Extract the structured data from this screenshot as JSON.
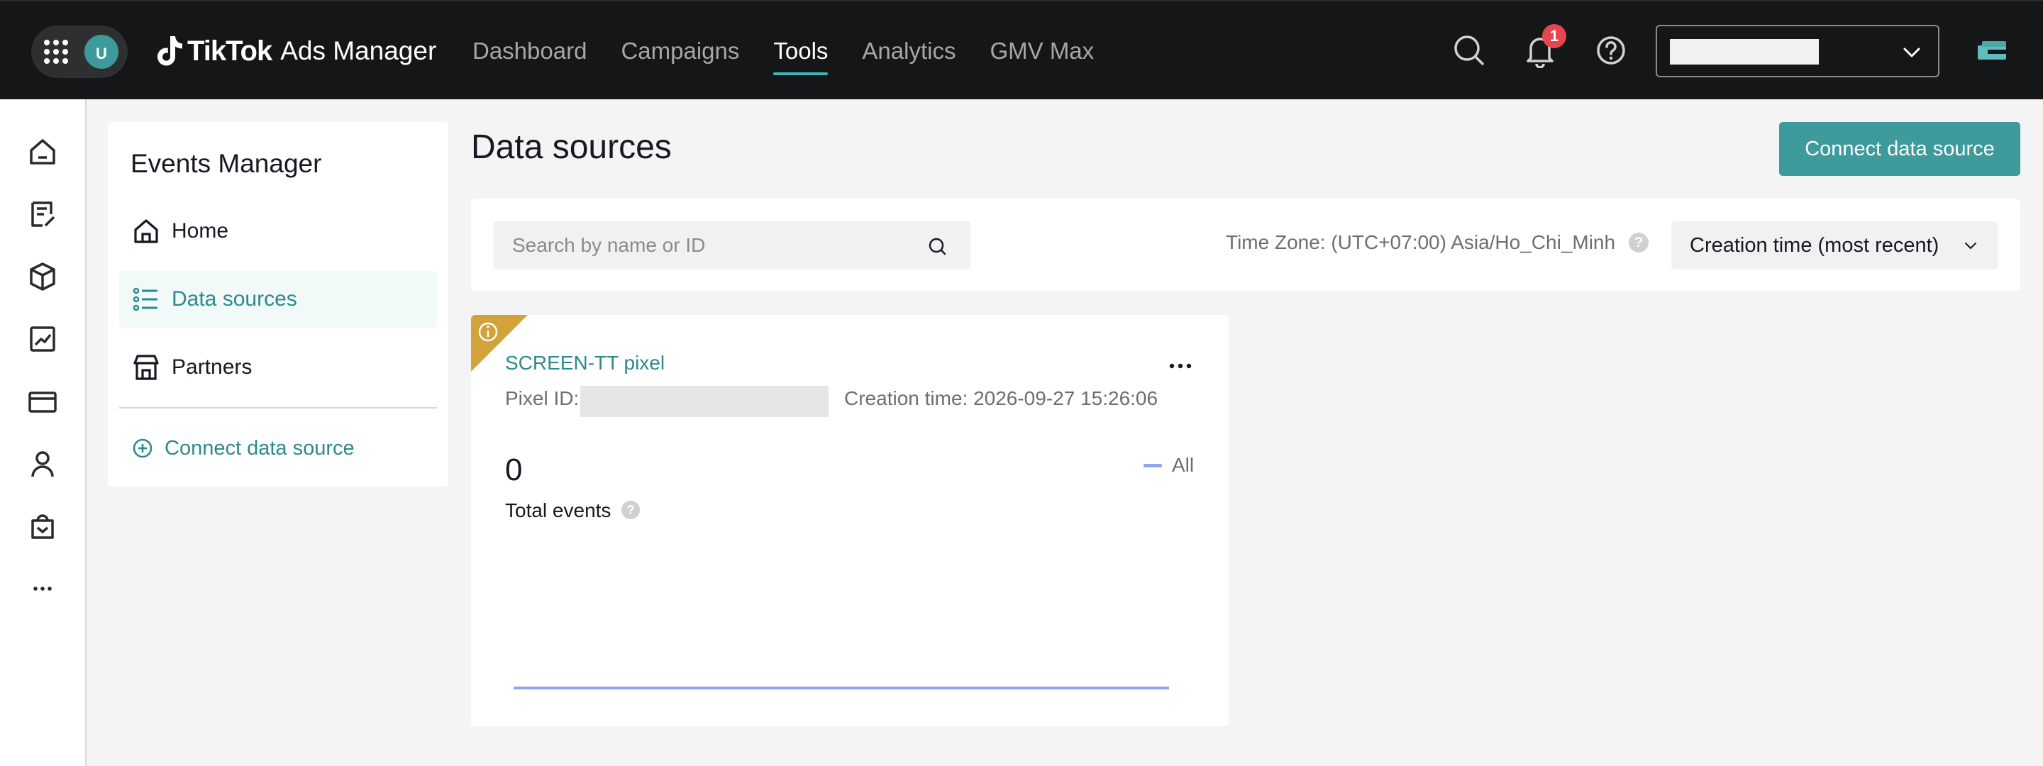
{
  "topbar": {
    "avatar_initial": "U",
    "brand_name": "TikTok",
    "brand_sub": "Ads Manager",
    "nav": [
      {
        "label": "Dashboard",
        "active": false
      },
      {
        "label": "Campaigns",
        "active": false
      },
      {
        "label": "Tools",
        "active": true
      },
      {
        "label": "Analytics",
        "active": false
      },
      {
        "label": "GMV Max",
        "active": false
      }
    ],
    "notifications_count": "1",
    "account_value": "",
    "icons": [
      "apps-icon",
      "search-icon",
      "bell-icon",
      "help-icon",
      "chevron-down-icon",
      "briefcase-icon"
    ]
  },
  "rail": {
    "icons": [
      "home-icon",
      "campaign-icon",
      "assets-icon",
      "reporting-icon",
      "payment-icon",
      "account-icon",
      "business-icon",
      "more-icon"
    ]
  },
  "events_manager": {
    "title": "Events Manager",
    "items": [
      {
        "label": "Home",
        "icon": "home-icon",
        "active": false
      },
      {
        "label": "Data sources",
        "icon": "list-icon",
        "active": true
      },
      {
        "label": "Partners",
        "icon": "store-icon",
        "active": false
      }
    ],
    "connect_label": "Connect data source"
  },
  "main": {
    "title": "Data sources",
    "connect_button": "Connect data source",
    "search_placeholder": "Search by name or ID",
    "search_value": "",
    "timezone": "Time Zone: (UTC+07:00) Asia/Ho_Chi_Minh",
    "sort_selected": "Creation time (most recent)"
  },
  "pixel_card": {
    "name": "SCREEN-TT pixel",
    "pixel_id_label": "Pixel ID:",
    "pixel_id_value": "",
    "creation_time": "Creation time: 2026-09-27 15:26:06",
    "total_value": "0",
    "total_label": "Total events",
    "legend": "All",
    "series_color": "#8fa6ec"
  },
  "colors": {
    "accent": "#3f9a9b",
    "accent_text": "#2b8a8d",
    "warning_corner": "#d1a33a",
    "topbar_bg": "#151617"
  }
}
